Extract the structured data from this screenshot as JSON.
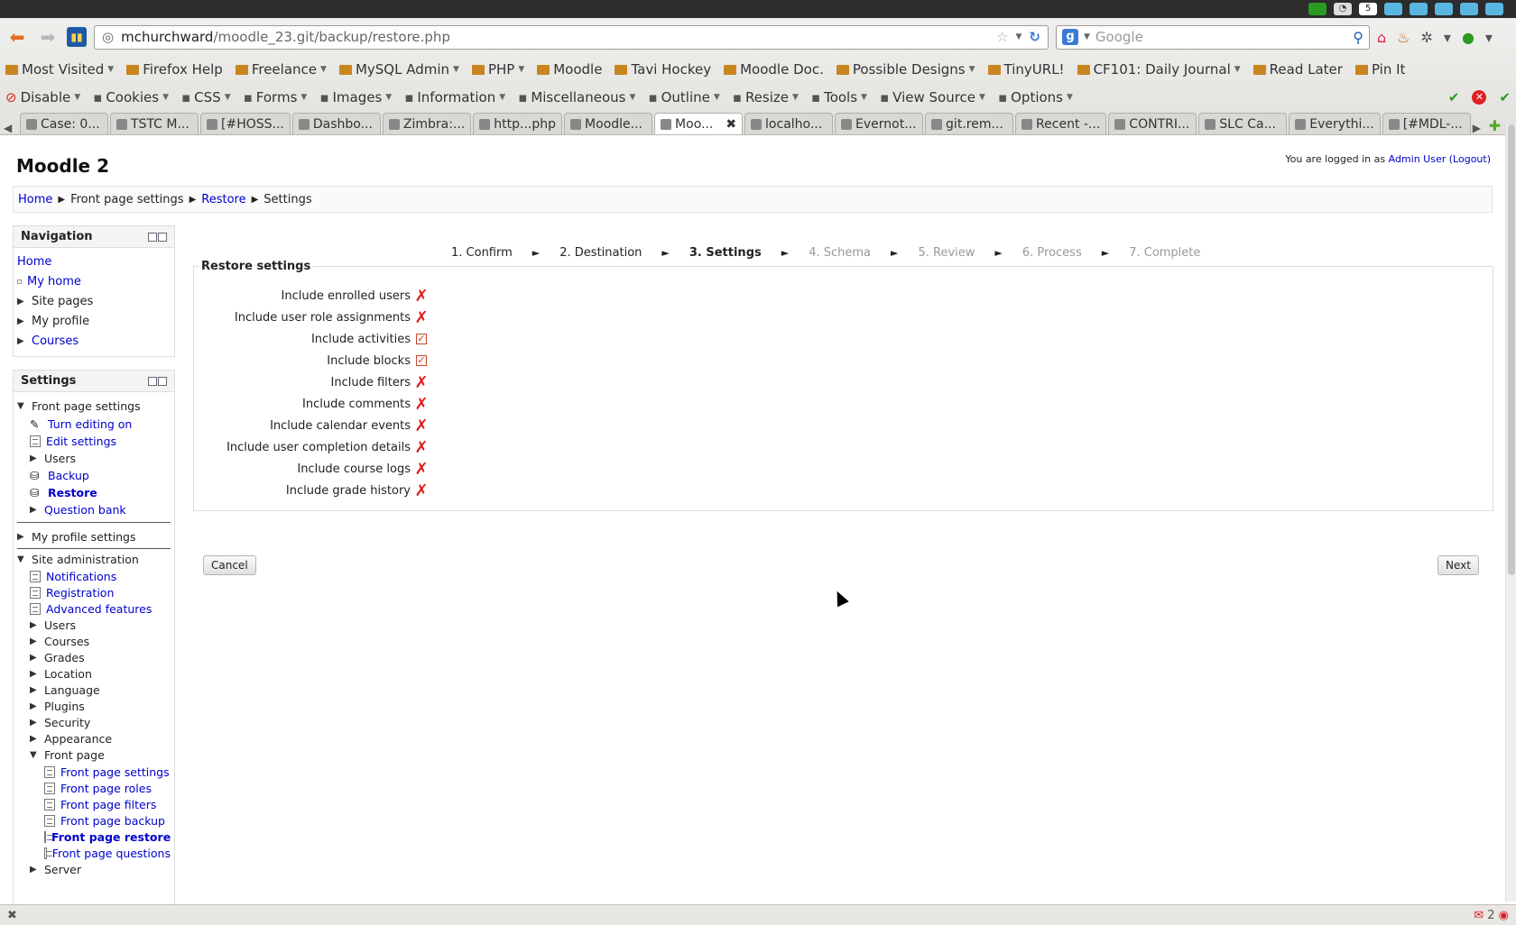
{
  "browser": {
    "url_host": "mchurchward",
    "url_path": "/moodle_23.git/backup/restore.php",
    "search_placeholder": "Google",
    "bookmarks": [
      {
        "label": "Most Visited",
        "dd": true
      },
      {
        "label": "Firefox Help",
        "dd": false
      },
      {
        "label": "Freelance",
        "dd": true
      },
      {
        "label": "MySQL Admin",
        "dd": true
      },
      {
        "label": "PHP",
        "dd": true
      },
      {
        "label": "Moodle",
        "dd": false
      },
      {
        "label": "Tavi Hockey",
        "dd": false
      },
      {
        "label": "Moodle Doc.",
        "dd": false
      },
      {
        "label": "Possible Designs",
        "dd": true
      },
      {
        "label": "TinyURL!",
        "dd": false
      },
      {
        "label": "CF101: Daily Journal",
        "dd": true
      },
      {
        "label": "Read Later",
        "dd": false
      },
      {
        "label": "Pin It",
        "dd": false
      }
    ],
    "devtools": [
      "Disable",
      "Cookies",
      "CSS",
      "Forms",
      "Images",
      "Information",
      "Miscellaneous",
      "Outline",
      "Resize",
      "Tools",
      "View Source",
      "Options"
    ],
    "tabs": [
      "Case: 0...",
      "TSTC M...",
      "[#HOSS...",
      "Dashbo...",
      "Zimbra:...",
      "http...php",
      "Moodle...",
      "Moo...",
      "localho...",
      "Evernot...",
      "git.rem...",
      "Recent -...",
      "CONTRI...",
      "SLC Ca...",
      "Everythi...",
      "[#MDL-..."
    ],
    "status_count": "2"
  },
  "site": {
    "title": "Moodle 2",
    "login_prefix": "You are logged in as",
    "login_user": "Admin User",
    "logout": "(Logout)"
  },
  "breadcrumb": {
    "items": [
      "Home",
      "Front page settings",
      "Restore",
      "Settings"
    ]
  },
  "navigation": {
    "title": "Navigation",
    "items": [
      "Home",
      "My home",
      "Site pages",
      "My profile",
      "Courses"
    ]
  },
  "settings": {
    "title": "Settings",
    "front_page_settings": "Front page settings",
    "fp_items": [
      "Turn editing on",
      "Edit settings",
      "Users",
      "Backup",
      "Restore",
      "Question bank"
    ],
    "my_profile_settings": "My profile settings",
    "site_admin": "Site administration",
    "sa_items": [
      "Notifications",
      "Registration",
      "Advanced features"
    ],
    "sa_folders": [
      "Users",
      "Courses",
      "Grades",
      "Location",
      "Language",
      "Plugins",
      "Security",
      "Appearance"
    ],
    "front_page": "Front page",
    "front_page_items": [
      "Front page settings",
      "Front page roles",
      "Front page filters",
      "Front page backup",
      "Front page restore",
      "Front page questions"
    ],
    "server": "Server"
  },
  "stepper": {
    "steps": [
      "1. Confirm",
      "2. Destination",
      "3. Settings",
      "4. Schema",
      "5. Review",
      "6. Process",
      "7. Complete"
    ],
    "sep": "►"
  },
  "restore": {
    "legend": "Restore settings",
    "rows": [
      {
        "label": "Include enrolled users",
        "checked": false
      },
      {
        "label": "Include user role assignments",
        "checked": false
      },
      {
        "label": "Include activities",
        "checked": true
      },
      {
        "label": "Include blocks",
        "checked": true
      },
      {
        "label": "Include filters",
        "checked": false
      },
      {
        "label": "Include comments",
        "checked": false
      },
      {
        "label": "Include calendar events",
        "checked": false
      },
      {
        "label": "Include user completion details",
        "checked": false
      },
      {
        "label": "Include course logs",
        "checked": false
      },
      {
        "label": "Include grade history",
        "checked": false
      }
    ],
    "cancel": "Cancel",
    "next": "Next"
  },
  "colors": {
    "link": "#0000cc",
    "cross": "#e01919",
    "check": "#c74a2c"
  }
}
